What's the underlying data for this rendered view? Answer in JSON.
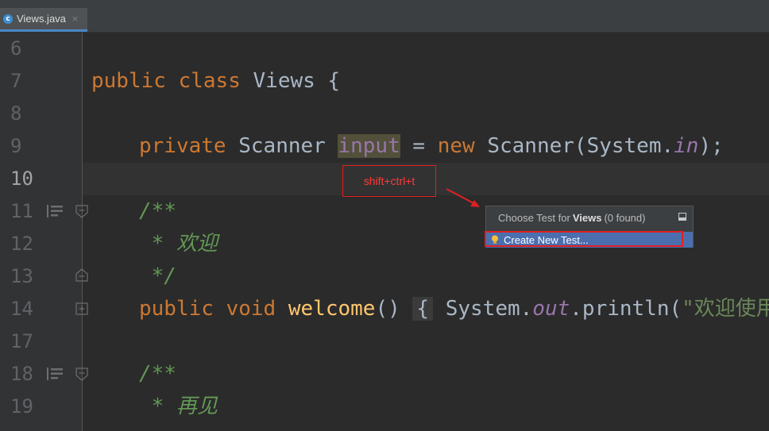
{
  "tab": {
    "filename": "Views.java",
    "icon": "java-class-icon",
    "close": "×"
  },
  "lines": [
    {
      "num": "6"
    },
    {
      "num": "7"
    },
    {
      "num": "8"
    },
    {
      "num": "9"
    },
    {
      "num": "10"
    },
    {
      "num": "11"
    },
    {
      "num": "12"
    },
    {
      "num": "13"
    },
    {
      "num": "14"
    },
    {
      "num": "17"
    },
    {
      "num": "18"
    },
    {
      "num": "19"
    }
  ],
  "code": {
    "l7": {
      "kw1": "public",
      "kw2": "class",
      "name": " Views {"
    },
    "l9": {
      "kw1": "private",
      "type": " Scanner ",
      "field": "input",
      "eq": " = ",
      "kw2": "new",
      "ctor": " Scanner(System.",
      "st": "in",
      "end": ");"
    },
    "l11": {
      "comment": "/**"
    },
    "l12": {
      "comment": " * 欢迎"
    },
    "l13": {
      "comment": " */"
    },
    "l14": {
      "kw1": "public",
      "kw2": "void",
      "fn": "welcome",
      "paren": "()",
      "brace": "{",
      "sys": " System.",
      "st": "out",
      "call": ".println(",
      "str": "\"欢迎使用XX"
    },
    "l18": {
      "comment": "/**"
    },
    "l19": {
      "comment": " * 再见"
    }
  },
  "hint": {
    "text": "shift+ctrl+t"
  },
  "popup": {
    "title_prefix": "Choose Test for",
    "title_class": "Views",
    "title_suffix": "(0 found)",
    "item": "Create New Test..."
  },
  "colors": {
    "editor_bg": "#2b2b2b",
    "keyword": "#cc7832",
    "field": "#9876aa",
    "method": "#ffc66d",
    "comment": "#629755",
    "string": "#6a8759",
    "selection": "#4b6eaf",
    "annotation_red": "#e02020"
  }
}
